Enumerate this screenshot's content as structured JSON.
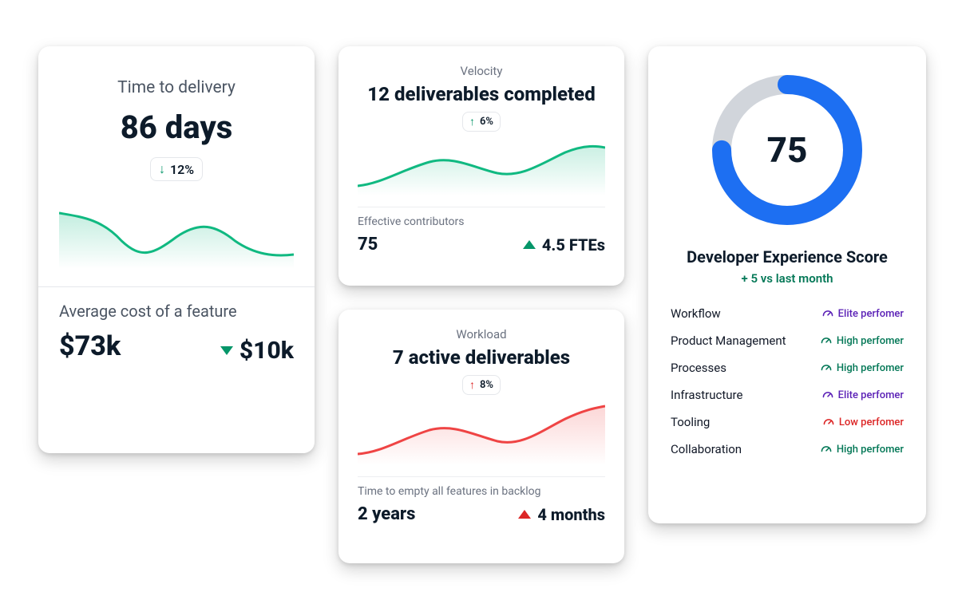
{
  "delivery": {
    "title": "Time to delivery",
    "value": "86 days",
    "change_pct": "12%",
    "change_direction": "down",
    "cost_title": "Average cost of a feature",
    "cost_value": "$73k",
    "cost_delta": "$10k",
    "cost_delta_direction": "down"
  },
  "velocity": {
    "title": "Velocity",
    "value": "12 deliverables completed",
    "change_pct": "6%",
    "change_direction": "up",
    "sub_title": "Effective contributors",
    "sub_value": "75",
    "sub_delta": "4.5 FTEs",
    "sub_delta_direction": "up"
  },
  "workload": {
    "title": "Workload",
    "value": "7 active deliverables",
    "change_pct": "8%",
    "change_direction": "up",
    "sub_title": "Time to empty all features in backlog",
    "sub_value": "2 years",
    "sub_delta": "4 months",
    "sub_delta_direction": "up"
  },
  "dx": {
    "score": "75",
    "score_pct": 75,
    "title": "Developer Experience Score",
    "subtitle": "+ 5 vs last month",
    "rows": [
      {
        "label": "Workflow",
        "level": "elite",
        "text": "Elite perfomer"
      },
      {
        "label": "Product Management",
        "level": "high",
        "text": "High perfomer"
      },
      {
        "label": "Processes",
        "level": "high",
        "text": "High perfomer"
      },
      {
        "label": "Infrastructure",
        "level": "elite",
        "text": "Elite perfomer"
      },
      {
        "label": "Tooling",
        "level": "low",
        "text": "Low perfomer"
      },
      {
        "label": "Collaboration",
        "level": "high",
        "text": "High perfomer"
      }
    ]
  },
  "colors": {
    "green": "#10b981",
    "red": "#ef4444",
    "blue": "#1d6ff2",
    "grey": "#d1d5db"
  },
  "chart_data": [
    {
      "type": "line",
      "title": "Time to delivery sparkline",
      "color": "#10b981",
      "fill": true,
      "x": [
        0,
        1,
        2,
        3,
        4,
        5,
        6,
        7,
        8,
        9
      ],
      "values": [
        75,
        68,
        40,
        28,
        30,
        50,
        58,
        48,
        35,
        25
      ],
      "ylim": [
        0,
        100
      ]
    },
    {
      "type": "line",
      "title": "Velocity sparkline",
      "color": "#10b981",
      "fill": true,
      "x": [
        0,
        1,
        2,
        3,
        4,
        5,
        6,
        7,
        8,
        9
      ],
      "values": [
        20,
        25,
        45,
        55,
        50,
        40,
        38,
        55,
        75,
        82
      ],
      "ylim": [
        0,
        100
      ]
    },
    {
      "type": "line",
      "title": "Workload sparkline",
      "color": "#ef4444",
      "fill": true,
      "x": [
        0,
        1,
        2,
        3,
        4,
        5,
        6,
        7,
        8,
        9
      ],
      "values": [
        18,
        22,
        40,
        52,
        48,
        38,
        36,
        52,
        72,
        85
      ],
      "ylim": [
        0,
        100
      ]
    },
    {
      "type": "pie",
      "title": "Developer Experience Score",
      "values": [
        75,
        25
      ],
      "labels": [
        "score",
        "remaining"
      ],
      "colors": [
        "#1d6ff2",
        "#d1d5db"
      ]
    }
  ]
}
